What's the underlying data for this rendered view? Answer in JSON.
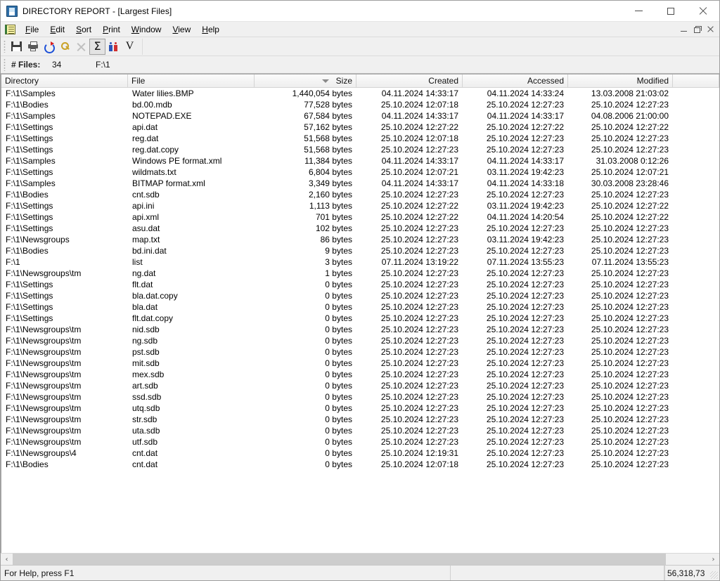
{
  "window": {
    "title": "DIRECTORY REPORT - [Largest Files]",
    "app_icon": "report-document-icon",
    "minimize_label": "Minimize",
    "maximize_label": "Maximize",
    "close_label": "Close"
  },
  "menubar": {
    "doc_icon": "document-icon",
    "items": [
      {
        "label": "File",
        "mnemonic": "F"
      },
      {
        "label": "Edit",
        "mnemonic": "E"
      },
      {
        "label": "Sort",
        "mnemonic": "S"
      },
      {
        "label": "Print",
        "mnemonic": "P"
      },
      {
        "label": "Window",
        "mnemonic": "W"
      },
      {
        "label": "View",
        "mnemonic": "V"
      },
      {
        "label": "Help",
        "mnemonic": "H"
      }
    ],
    "mdi": {
      "minimize_label": "Minimize child window",
      "restore_label": "Restore child window",
      "close_label": "Close child window"
    }
  },
  "toolbar": {
    "buttons": [
      {
        "name": "save-button",
        "icon": "save-icon",
        "label": "Save",
        "state": "enabled"
      },
      {
        "name": "print-button",
        "icon": "printer-icon",
        "label": "Print",
        "state": "enabled"
      },
      {
        "name": "refresh-button",
        "icon": "refresh-icon",
        "label": "Refresh",
        "state": "enabled"
      },
      {
        "name": "find-button",
        "icon": "search-icon",
        "label": "Find",
        "state": "enabled"
      },
      {
        "name": "delete-button",
        "icon": "close-x-icon",
        "label": "Delete",
        "state": "disabled"
      },
      {
        "name": "sum-button",
        "icon": "sigma-icon",
        "label": "Sum",
        "state": "pressed"
      },
      {
        "name": "owner-button",
        "icon": "people-icon",
        "label": "Owner",
        "state": "enabled"
      },
      {
        "name": "version-button",
        "icon": "v-icon",
        "label": "Version",
        "state": "enabled"
      }
    ]
  },
  "infobar": {
    "files_label": "# Files:",
    "files_count": "34",
    "path": "F:\\1"
  },
  "table": {
    "columns": [
      {
        "key": "directory",
        "label": "Directory",
        "align": "left",
        "sorted": false
      },
      {
        "key": "file",
        "label": "File",
        "align": "left",
        "sorted": false
      },
      {
        "key": "size",
        "label": "Size",
        "align": "right",
        "sorted": true,
        "sort_direction": "descending"
      },
      {
        "key": "created",
        "label": "Created",
        "align": "right",
        "sorted": false
      },
      {
        "key": "accessed",
        "label": "Accessed",
        "align": "right",
        "sorted": false
      },
      {
        "key": "modified",
        "label": "Modified",
        "align": "right",
        "sorted": false
      }
    ],
    "rows": [
      [
        "F:\\1\\Samples",
        "Water lilies.BMP",
        "1,440,054 bytes",
        "04.11.2024 14:33:17",
        "04.11.2024 14:33:24",
        "13.03.2008 21:03:02"
      ],
      [
        "F:\\1\\Bodies",
        "bd.00.mdb",
        "77,528 bytes",
        "25.10.2024 12:07:18",
        "25.10.2024 12:27:23",
        "25.10.2024 12:27:23"
      ],
      [
        "F:\\1\\Samples",
        "NOTEPAD.EXE",
        "67,584 bytes",
        "04.11.2024 14:33:17",
        "04.11.2024 14:33:17",
        "04.08.2006 21:00:00"
      ],
      [
        "F:\\1\\Settings",
        "api.dat",
        "57,162 bytes",
        "25.10.2024 12:27:22",
        "25.10.2024 12:27:22",
        "25.10.2024 12:27:22"
      ],
      [
        "F:\\1\\Settings",
        "reg.dat",
        "51,568 bytes",
        "25.10.2024 12:07:18",
        "25.10.2024 12:27:23",
        "25.10.2024 12:27:23"
      ],
      [
        "F:\\1\\Settings",
        "reg.dat.copy",
        "51,568 bytes",
        "25.10.2024 12:27:23",
        "25.10.2024 12:27:23",
        "25.10.2024 12:27:23"
      ],
      [
        "F:\\1\\Samples",
        "Windows PE format.xml",
        "11,384 bytes",
        "04.11.2024 14:33:17",
        "04.11.2024 14:33:17",
        "31.03.2008 0:12:26"
      ],
      [
        "F:\\1\\Settings",
        "wildmats.txt",
        "6,804 bytes",
        "25.10.2024 12:07:21",
        "03.11.2024 19:42:23",
        "25.10.2024 12:07:21"
      ],
      [
        "F:\\1\\Samples",
        "BITMAP format.xml",
        "3,349 bytes",
        "04.11.2024 14:33:17",
        "04.11.2024 14:33:18",
        "30.03.2008 23:28:46"
      ],
      [
        "F:\\1\\Bodies",
        "cnt.sdb",
        "2,160 bytes",
        "25.10.2024 12:27:23",
        "25.10.2024 12:27:23",
        "25.10.2024 12:27:23"
      ],
      [
        "F:\\1\\Settings",
        "api.ini",
        "1,113 bytes",
        "25.10.2024 12:27:22",
        "03.11.2024 19:42:23",
        "25.10.2024 12:27:22"
      ],
      [
        "F:\\1\\Settings",
        "api.xml",
        "701 bytes",
        "25.10.2024 12:27:22",
        "04.11.2024 14:20:54",
        "25.10.2024 12:27:22"
      ],
      [
        "F:\\1\\Settings",
        "asu.dat",
        "102 bytes",
        "25.10.2024 12:27:23",
        "25.10.2024 12:27:23",
        "25.10.2024 12:27:23"
      ],
      [
        "F:\\1\\Newsgroups",
        "map.txt",
        "86 bytes",
        "25.10.2024 12:27:23",
        "03.11.2024 19:42:23",
        "25.10.2024 12:27:23"
      ],
      [
        "F:\\1\\Bodies",
        "bd.ini.dat",
        "9 bytes",
        "25.10.2024 12:27:23",
        "25.10.2024 12:27:23",
        "25.10.2024 12:27:23"
      ],
      [
        "F:\\1",
        "list",
        "3 bytes",
        "07.11.2024 13:19:22",
        "07.11.2024 13:55:23",
        "07.11.2024 13:55:23"
      ],
      [
        "F:\\1\\Newsgroups\\tm",
        "ng.dat",
        "1 bytes",
        "25.10.2024 12:27:23",
        "25.10.2024 12:27:23",
        "25.10.2024 12:27:23"
      ],
      [
        "F:\\1\\Settings",
        "flt.dat",
        "0 bytes",
        "25.10.2024 12:27:23",
        "25.10.2024 12:27:23",
        "25.10.2024 12:27:23"
      ],
      [
        "F:\\1\\Settings",
        "bla.dat.copy",
        "0 bytes",
        "25.10.2024 12:27:23",
        "25.10.2024 12:27:23",
        "25.10.2024 12:27:23"
      ],
      [
        "F:\\1\\Settings",
        "bla.dat",
        "0 bytes",
        "25.10.2024 12:27:23",
        "25.10.2024 12:27:23",
        "25.10.2024 12:27:23"
      ],
      [
        "F:\\1\\Settings",
        "flt.dat.copy",
        "0 bytes",
        "25.10.2024 12:27:23",
        "25.10.2024 12:27:23",
        "25.10.2024 12:27:23"
      ],
      [
        "F:\\1\\Newsgroups\\tm",
        "nid.sdb",
        "0 bytes",
        "25.10.2024 12:27:23",
        "25.10.2024 12:27:23",
        "25.10.2024 12:27:23"
      ],
      [
        "F:\\1\\Newsgroups\\tm",
        "ng.sdb",
        "0 bytes",
        "25.10.2024 12:27:23",
        "25.10.2024 12:27:23",
        "25.10.2024 12:27:23"
      ],
      [
        "F:\\1\\Newsgroups\\tm",
        "pst.sdb",
        "0 bytes",
        "25.10.2024 12:27:23",
        "25.10.2024 12:27:23",
        "25.10.2024 12:27:23"
      ],
      [
        "F:\\1\\Newsgroups\\tm",
        "mit.sdb",
        "0 bytes",
        "25.10.2024 12:27:23",
        "25.10.2024 12:27:23",
        "25.10.2024 12:27:23"
      ],
      [
        "F:\\1\\Newsgroups\\tm",
        "mex.sdb",
        "0 bytes",
        "25.10.2024 12:27:23",
        "25.10.2024 12:27:23",
        "25.10.2024 12:27:23"
      ],
      [
        "F:\\1\\Newsgroups\\tm",
        "art.sdb",
        "0 bytes",
        "25.10.2024 12:27:23",
        "25.10.2024 12:27:23",
        "25.10.2024 12:27:23"
      ],
      [
        "F:\\1\\Newsgroups\\tm",
        "ssd.sdb",
        "0 bytes",
        "25.10.2024 12:27:23",
        "25.10.2024 12:27:23",
        "25.10.2024 12:27:23"
      ],
      [
        "F:\\1\\Newsgroups\\tm",
        "utq.sdb",
        "0 bytes",
        "25.10.2024 12:27:23",
        "25.10.2024 12:27:23",
        "25.10.2024 12:27:23"
      ],
      [
        "F:\\1\\Newsgroups\\tm",
        "str.sdb",
        "0 bytes",
        "25.10.2024 12:27:23",
        "25.10.2024 12:27:23",
        "25.10.2024 12:27:23"
      ],
      [
        "F:\\1\\Newsgroups\\tm",
        "uta.sdb",
        "0 bytes",
        "25.10.2024 12:27:23",
        "25.10.2024 12:27:23",
        "25.10.2024 12:27:23"
      ],
      [
        "F:\\1\\Newsgroups\\tm",
        "utf.sdb",
        "0 bytes",
        "25.10.2024 12:27:23",
        "25.10.2024 12:27:23",
        "25.10.2024 12:27:23"
      ],
      [
        "F:\\1\\Newsgroups\\4",
        "cnt.dat",
        "0 bytes",
        "25.10.2024 12:19:31",
        "25.10.2024 12:27:23",
        "25.10.2024 12:27:23"
      ],
      [
        "F:\\1\\Bodies",
        "cnt.dat",
        "0 bytes",
        "25.10.2024 12:07:18",
        "25.10.2024 12:27:23",
        "25.10.2024 12:27:23"
      ]
    ]
  },
  "hscroll": {
    "left_arrow": "‹",
    "right_arrow": "›"
  },
  "statusbar": {
    "hint": "For Help, press F1",
    "total_bytes": "56,318,73 "
  }
}
